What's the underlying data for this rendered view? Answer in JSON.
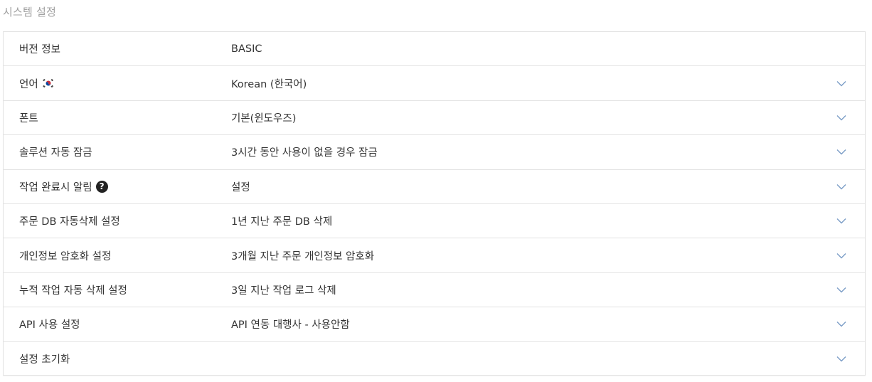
{
  "page": {
    "title": "시스템 설정"
  },
  "colors": {
    "title_text": "#a0a0a0",
    "border": "#e2e2e2",
    "chevron": "#7a9cc6",
    "help_icon_bg": "#222222"
  },
  "settings": {
    "rows": [
      {
        "label": "버전 정보",
        "value": "BASIC",
        "has_chevron": false
      },
      {
        "label": "언어",
        "label_icon": "korea-flag-icon",
        "value": "Korean (한국어)",
        "has_chevron": true
      },
      {
        "label": "폰트",
        "value": "기본(윈도우즈)",
        "has_chevron": true
      },
      {
        "label": "솔루션 자동 잠금",
        "value": "3시간 동안 사용이 없을 경우 잠금",
        "has_chevron": true
      },
      {
        "label": "작업 완료시 알림",
        "label_icon": "help-icon",
        "help_symbol": "?",
        "value": "설정",
        "has_chevron": true
      },
      {
        "label": "주문 DB 자동삭제 설정",
        "value": "1년 지난 주문 DB 삭제",
        "has_chevron": true
      },
      {
        "label": "개인정보 암호화 설정",
        "value": "3개월 지난 주문 개인정보 암호화",
        "has_chevron": true
      },
      {
        "label": "누적 작업 자동 삭제 설정",
        "value": "3일 지난 작업 로그 삭제",
        "has_chevron": true
      },
      {
        "label": "API 사용 설정",
        "value": "API 연동 대행사 - 사용안함",
        "has_chevron": true
      },
      {
        "label": "설정 초기화",
        "value": "",
        "has_chevron": true
      }
    ]
  }
}
